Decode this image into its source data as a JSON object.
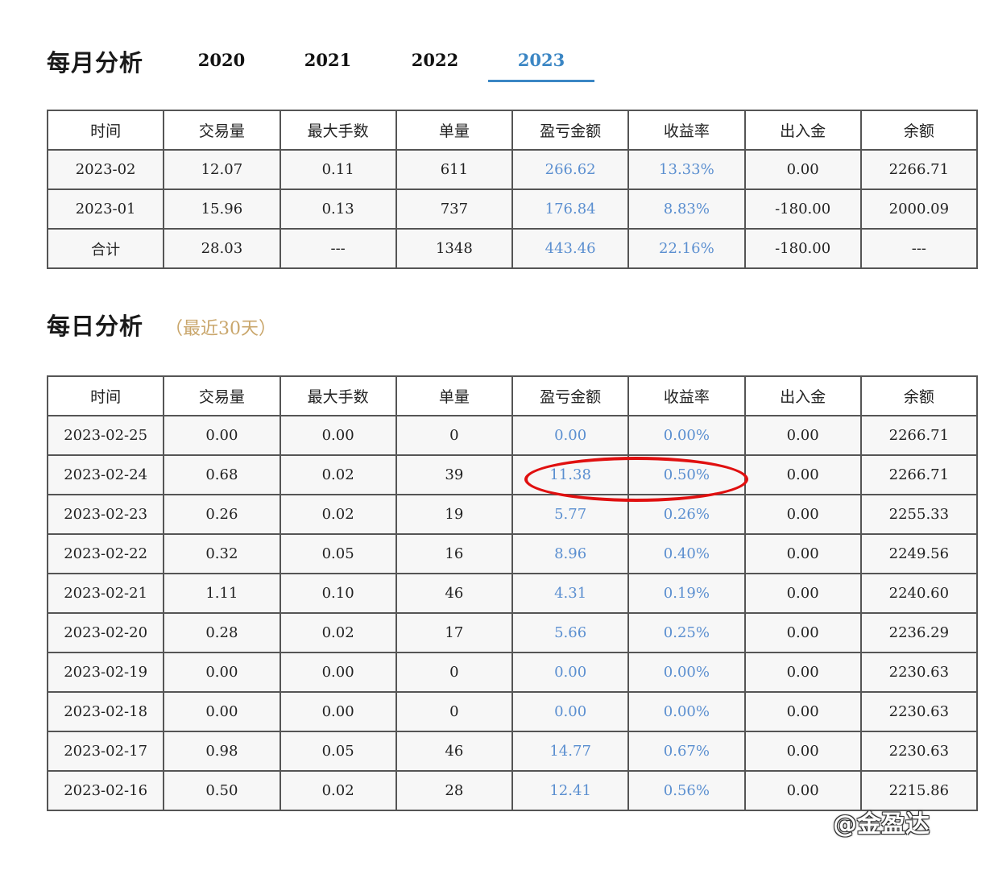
{
  "monthly": {
    "title": "每月分析",
    "year_tabs": [
      "2020",
      "2021",
      "2022",
      "2023"
    ],
    "active_tab": "2023",
    "columns": [
      "时间",
      "交易量",
      "最大手数",
      "单量",
      "盈亏金额",
      "收益率",
      "出入金",
      "余额"
    ],
    "rows": [
      [
        "2023-02",
        "12.07",
        "0.11",
        "611",
        "266.62",
        "13.33%",
        "0.00",
        "2266.71"
      ],
      [
        "2023-01",
        "15.96",
        "0.13",
        "737",
        "176.84",
        "8.83%",
        "-180.00",
        "2000.09"
      ],
      [
        "合计",
        "28.03",
        "---",
        "1348",
        "443.46",
        "22.16%",
        "-180.00",
        "---"
      ]
    ]
  },
  "daily": {
    "title": "每日分析",
    "subtitle": "（最近30天）",
    "columns": [
      "时间",
      "交易量",
      "最大手数",
      "单量",
      "盈亏金额",
      "收益率",
      "出入金",
      "余额"
    ],
    "rows": [
      [
        "2023-02-25",
        "0.00",
        "0.00",
        "0",
        "0.00",
        "0.00%",
        "0.00",
        "2266.71"
      ],
      [
        "2023-02-24",
        "0.68",
        "0.02",
        "39",
        "11.38",
        "0.50%",
        "0.00",
        "2266.71"
      ],
      [
        "2023-02-23",
        "0.26",
        "0.02",
        "19",
        "5.77",
        "0.26%",
        "0.00",
        "2255.33"
      ],
      [
        "2023-02-22",
        "0.32",
        "0.05",
        "16",
        "8.96",
        "0.40%",
        "0.00",
        "2249.56"
      ],
      [
        "2023-02-21",
        "1.11",
        "0.10",
        "46",
        "4.31",
        "0.19%",
        "0.00",
        "2240.60"
      ],
      [
        "2023-02-20",
        "0.28",
        "0.02",
        "17",
        "5.66",
        "0.25%",
        "0.00",
        "2236.29"
      ],
      [
        "2023-02-19",
        "0.00",
        "0.00",
        "0",
        "0.00",
        "0.00%",
        "0.00",
        "2230.63"
      ],
      [
        "2023-02-18",
        "0.00",
        "0.00",
        "0",
        "0.00",
        "0.00%",
        "0.00",
        "2230.63"
      ],
      [
        "2023-02-17",
        "0.98",
        "0.05",
        "46",
        "14.77",
        "0.67%",
        "0.00",
        "2230.63"
      ],
      [
        "2023-02-16",
        "0.50",
        "0.02",
        "28",
        "12.41",
        "0.56%",
        "0.00",
        "2215.86"
      ]
    ],
    "highlighted_row": "2023-02-24"
  },
  "watermark": "@金盈达",
  "colors": {
    "accent_blue": "#3b86c4",
    "value_blue": "#5b8fd0",
    "subtitle_gold": "#c9a66b",
    "highlight_red": "#e01010"
  }
}
